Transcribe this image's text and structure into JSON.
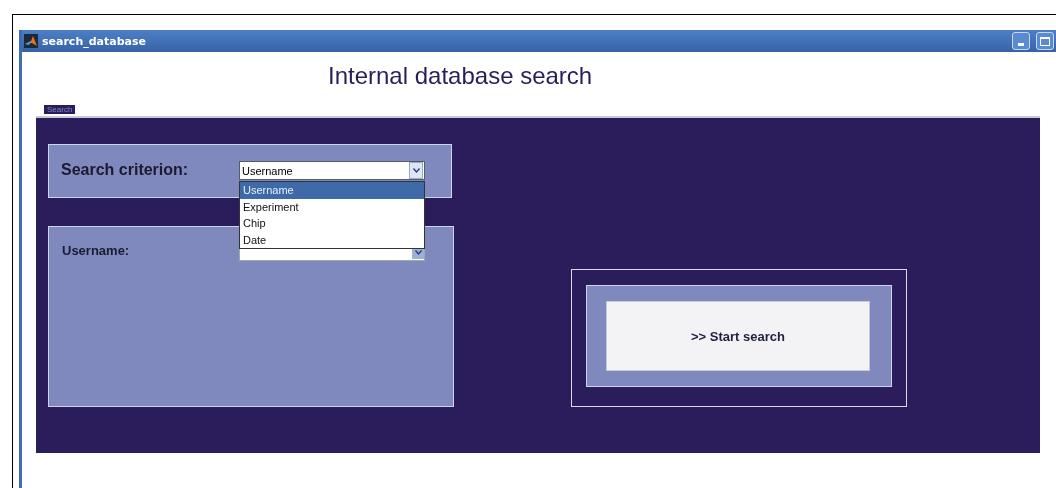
{
  "window": {
    "title": "search_database"
  },
  "heading": "Internal database search",
  "panel": {
    "title": "Search"
  },
  "criterion": {
    "label": "Search criterion:",
    "value": "Username",
    "expanded": true,
    "options": [
      {
        "label": "Username",
        "selected": true
      },
      {
        "label": "Experiment",
        "selected": false
      },
      {
        "label": "Chip",
        "selected": false
      },
      {
        "label": "Date",
        "selected": false
      }
    ]
  },
  "filter": {
    "label": "Username:"
  },
  "search_button": {
    "label": ">> Start search"
  }
}
